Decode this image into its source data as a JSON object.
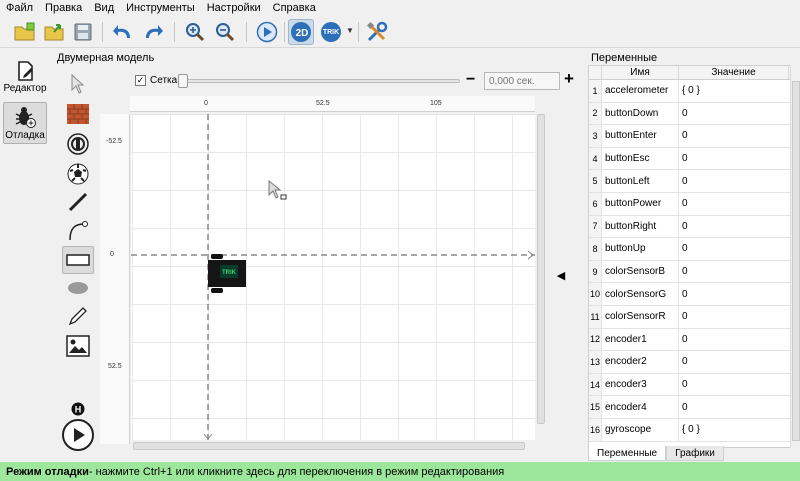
{
  "menu": [
    "Файл",
    "Правка",
    "Вид",
    "Инструменты",
    "Настройки",
    "Справка"
  ],
  "toolbar": {
    "buttons": [
      "new-project-icon",
      "open-icon",
      "save-icon",
      "undo-icon",
      "redo-icon",
      "zoom-in-icon",
      "zoom-out-icon",
      "run-icon",
      "2d-model-icon",
      "trik-robot-icon",
      "settings-tools-icon"
    ],
    "label_2d": "2D",
    "label_trik": "TRIK"
  },
  "modes": [
    {
      "label": "Редактор",
      "icon": "editor-icon",
      "active": false
    },
    {
      "label": "Отладка",
      "icon": "debug-bug-icon",
      "active": true
    }
  ],
  "model_panel": {
    "title": "Двумерная модель",
    "grid_label": "Сетка",
    "grid_checked": true,
    "time_placeholder": "0,000 сек.",
    "ruler_h": [
      "0",
      "52.5",
      "105"
    ],
    "ruler_v": [
      "-52.5",
      "0",
      "52.5"
    ]
  },
  "palette": [
    "pointer-icon",
    "wall-icon",
    "skittle-icon",
    "ball-icon",
    "line-icon",
    "bezier-curve-icon",
    "rectangle-icon",
    "ellipse-icon",
    "pencil-icon",
    "image-icon"
  ],
  "variables": {
    "title": "Переменные",
    "col_name": "Имя",
    "col_value": "Значение",
    "rows": [
      {
        "n": "1",
        "name": "accelerometer",
        "value": "{ 0 }"
      },
      {
        "n": "2",
        "name": "buttonDown",
        "value": "0"
      },
      {
        "n": "3",
        "name": "buttonEnter",
        "value": "0"
      },
      {
        "n": "4",
        "name": "buttonEsc",
        "value": "0"
      },
      {
        "n": "5",
        "name": "buttonLeft",
        "value": "0"
      },
      {
        "n": "6",
        "name": "buttonPower",
        "value": "0"
      },
      {
        "n": "7",
        "name": "buttonRight",
        "value": "0"
      },
      {
        "n": "8",
        "name": "buttonUp",
        "value": "0"
      },
      {
        "n": "9",
        "name": "colorSensorB",
        "value": "0"
      },
      {
        "n": "10",
        "name": "colorSensorG",
        "value": "0"
      },
      {
        "n": "11",
        "name": "colorSensorR",
        "value": "0"
      },
      {
        "n": "12",
        "name": "encoder1",
        "value": "0"
      },
      {
        "n": "13",
        "name": "encoder2",
        "value": "0"
      },
      {
        "n": "14",
        "name": "encoder3",
        "value": "0"
      },
      {
        "n": "15",
        "name": "encoder4",
        "value": "0"
      },
      {
        "n": "16",
        "name": "gyroscope",
        "value": "{ 0 }"
      }
    ],
    "tabs": [
      "Переменные",
      "Графики"
    ]
  },
  "status": {
    "bold": "Режим отладки",
    "text": " - нажмите Ctrl+1 или кликните здесь для переключения в режим редактирования"
  },
  "colors": {
    "status_bg": "#9ce79c",
    "accent_blue": "#2d6fb8",
    "trik_green": "#3bd16f"
  }
}
